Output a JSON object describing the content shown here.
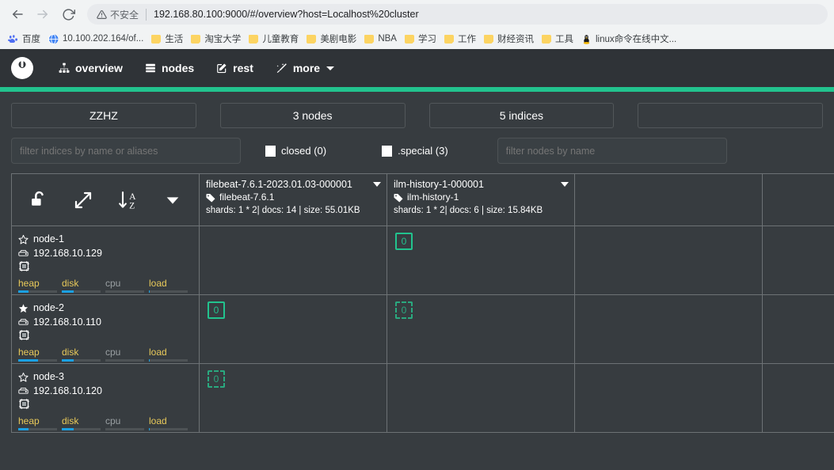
{
  "browser": {
    "back_icon": "back-arrow-icon",
    "forward_icon": "forward-arrow-icon",
    "reload_icon": "reload-icon",
    "security_label": "不安全",
    "url": "192.168.80.100:9000/#/overview?host=Localhost%20cluster",
    "bookmarks": [
      {
        "label": "百度",
        "icon": "baidu-icon"
      },
      {
        "label": "10.100.202.164/of...",
        "icon": "globe-icon"
      },
      {
        "label": "生活",
        "icon": "folder-icon"
      },
      {
        "label": "淘宝大学",
        "icon": "folder-icon"
      },
      {
        "label": "儿童教育",
        "icon": "folder-icon"
      },
      {
        "label": "美剧电影",
        "icon": "folder-icon"
      },
      {
        "label": "NBA",
        "icon": "folder-icon"
      },
      {
        "label": "学习",
        "icon": "folder-icon"
      },
      {
        "label": "工作",
        "icon": "folder-icon"
      },
      {
        "label": "财经资讯",
        "icon": "folder-icon"
      },
      {
        "label": "工具",
        "icon": "folder-icon"
      },
      {
        "label": "linux命令在线中文...",
        "icon": "tux-icon"
      }
    ]
  },
  "app": {
    "brand": "cerebro",
    "accent_color": "#22c38e",
    "nav": [
      {
        "label": "overview",
        "icon": "sitemap-icon"
      },
      {
        "label": "nodes",
        "icon": "server-icon"
      },
      {
        "label": "rest",
        "icon": "edit-square-icon"
      },
      {
        "label": "more",
        "icon": "magic-wand-icon",
        "has_caret": true
      }
    ]
  },
  "stats": [
    {
      "label": "ZZHZ"
    },
    {
      "label": "3 nodes"
    },
    {
      "label": "5 indices"
    },
    {
      "label": ""
    }
  ],
  "filters": {
    "indices_placeholder": "filter indices by name or aliases",
    "indices_value": "",
    "nodes_placeholder": "filter nodes by name",
    "nodes_value": "",
    "closed_label": "closed (0)",
    "special_label": ".special (3)"
  },
  "toolbar": {
    "icons": [
      {
        "name": "unlock-icon",
        "title": "unlock"
      },
      {
        "name": "expand-arrows-icon",
        "title": "expand"
      },
      {
        "name": "sort-alpha-desc-icon",
        "title": "sort a-z"
      },
      {
        "name": "caret-down-icon",
        "title": "more"
      }
    ]
  },
  "indices": [
    {
      "name": "filebeat-7.6.1-2023.01.03-000001",
      "alias": "filebeat-7.6.1",
      "meta": "shards: 1 * 2| docs: 14 | size: 55.01KB"
    },
    {
      "name": "ilm-history-1-000001",
      "alias": "ilm-history-1",
      "meta": "shards: 1 * 2| docs: 6 | size: 15.84KB"
    }
  ],
  "nodes": [
    {
      "name": "node-1",
      "ip": "192.168.10.129",
      "master": false,
      "gauges": [
        {
          "label": "heap",
          "pct": 27,
          "dim": false
        },
        {
          "label": "disk",
          "pct": 30,
          "dim": false
        },
        {
          "label": "cpu",
          "pct": 0,
          "dim": true
        },
        {
          "label": "load",
          "pct": 3,
          "dim": false
        }
      ],
      "shards": [
        {
          "index": "filebeat-7.6.1-2023.01.03-000001",
          "shard": null,
          "type": null
        },
        {
          "index": "ilm-history-1-000001",
          "shard": "0",
          "type": "primary"
        }
      ]
    },
    {
      "name": "node-2",
      "ip": "192.168.10.110",
      "master": true,
      "gauges": [
        {
          "label": "heap",
          "pct": 50,
          "dim": false
        },
        {
          "label": "disk",
          "pct": 30,
          "dim": false
        },
        {
          "label": "cpu",
          "pct": 0,
          "dim": true
        },
        {
          "label": "load",
          "pct": 3,
          "dim": false
        }
      ],
      "shards": [
        {
          "index": "filebeat-7.6.1-2023.01.03-000001",
          "shard": "0",
          "type": "primary"
        },
        {
          "index": "ilm-history-1-000001",
          "shard": "0",
          "type": "replica"
        }
      ]
    },
    {
      "name": "node-3",
      "ip": "192.168.10.120",
      "master": false,
      "gauges": [
        {
          "label": "heap",
          "pct": 27,
          "dim": false
        },
        {
          "label": "disk",
          "pct": 30,
          "dim": false
        },
        {
          "label": "cpu",
          "pct": 0,
          "dim": true
        },
        {
          "label": "load",
          "pct": 3,
          "dim": false
        }
      ],
      "shards": [
        {
          "index": "filebeat-7.6.1-2023.01.03-000001",
          "shard": "0",
          "type": "replica"
        },
        {
          "index": "ilm-history-1-000001",
          "shard": null,
          "type": null
        }
      ]
    }
  ]
}
